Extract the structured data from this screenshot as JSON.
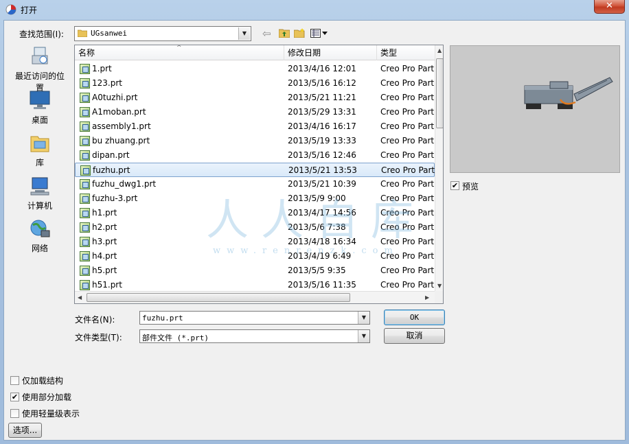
{
  "window": {
    "title": "打开",
    "close_glyph": "✕"
  },
  "lookin": {
    "label": "查找范围(I):",
    "value": "UGsanwei"
  },
  "places": [
    {
      "label": "最近访问的位置",
      "icon": "recent-places-icon"
    },
    {
      "label": "桌面",
      "icon": "desktop-icon"
    },
    {
      "label": "库",
      "icon": "libraries-icon"
    },
    {
      "label": "计算机",
      "icon": "computer-icon"
    },
    {
      "label": "网络",
      "icon": "network-icon"
    }
  ],
  "columns": {
    "name": "名称",
    "date": "修改日期",
    "type": "类型"
  },
  "files": [
    {
      "name": "1.prt",
      "date": "2013/4/16 12:01",
      "type": "Creo Pro Part"
    },
    {
      "name": "123.prt",
      "date": "2013/5/16 16:12",
      "type": "Creo Pro Part"
    },
    {
      "name": "A0tuzhi.prt",
      "date": "2013/5/21 11:21",
      "type": "Creo Pro Part"
    },
    {
      "name": "A1moban.prt",
      "date": "2013/5/29 13:31",
      "type": "Creo Pro Part"
    },
    {
      "name": "assembly1.prt",
      "date": "2013/4/16 16:17",
      "type": "Creo Pro Part"
    },
    {
      "name": "bu zhuang.prt",
      "date": "2013/5/19 13:33",
      "type": "Creo Pro Part"
    },
    {
      "name": "dipan.prt",
      "date": "2013/5/16 12:46",
      "type": "Creo Pro Part"
    },
    {
      "name": "fuzhu.prt",
      "date": "2013/5/21 13:53",
      "type": "Creo Pro Part",
      "selected": true
    },
    {
      "name": "fuzhu_dwg1.prt",
      "date": "2013/5/21 10:39",
      "type": "Creo Pro Part"
    },
    {
      "name": "fuzhu-3.prt",
      "date": "2013/5/9 9:00",
      "type": "Creo Pro Part"
    },
    {
      "name": "h1.prt",
      "date": "2013/4/17 14:56",
      "type": "Creo Pro Part"
    },
    {
      "name": "h2.prt",
      "date": "2013/5/6 7:38",
      "type": "Creo Pro Part"
    },
    {
      "name": "h3.prt",
      "date": "2013/4/18 16:34",
      "type": "Creo Pro Part"
    },
    {
      "name": "h4.prt",
      "date": "2013/4/19 6:49",
      "type": "Creo Pro Part"
    },
    {
      "name": "h5.prt",
      "date": "2013/5/5 9:35",
      "type": "Creo Pro Part"
    },
    {
      "name": "h51.prt",
      "date": "2013/5/16 11:35",
      "type": "Creo Pro Part"
    }
  ],
  "preview": {
    "label": "预览",
    "checked": true
  },
  "filename": {
    "label": "文件名(N):",
    "value": "fuzhu.prt"
  },
  "filetype": {
    "label": "文件类型(T):",
    "value": "部件文件 (*.prt)"
  },
  "buttons": {
    "ok": "OK",
    "cancel": "取消",
    "options": "选项..."
  },
  "options": [
    {
      "label": "仅加载结构",
      "checked": false
    },
    {
      "label": "使用部分加载",
      "checked": true
    },
    {
      "label": "使用轻量级表示",
      "checked": false
    }
  ],
  "watermark": {
    "text": "人人自库",
    "url": "www.renrenzk.com"
  },
  "colors": {
    "title_bar": "#b9d1ea",
    "close_button": "#c8432a",
    "selected_row": "#d9e9f9"
  }
}
